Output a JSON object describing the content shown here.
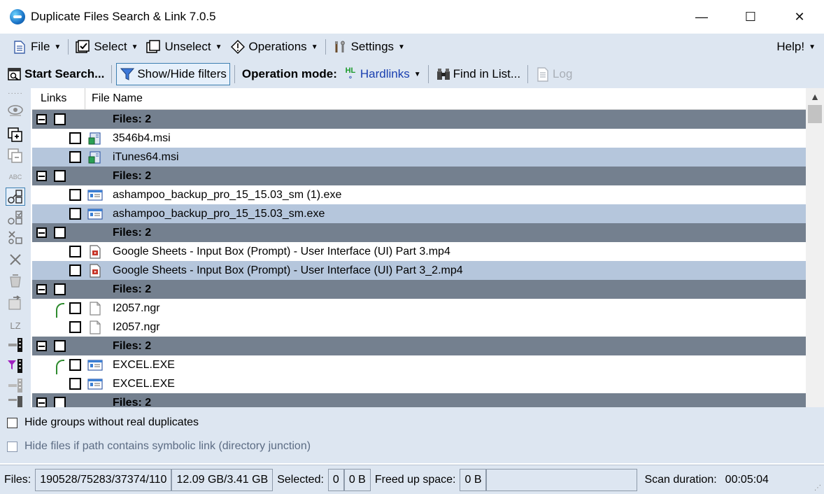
{
  "window": {
    "title": "Duplicate Files Search & Link 7.0.5",
    "minimize_glyph": "—",
    "maximize_glyph": "☐",
    "close_glyph": "✕"
  },
  "menu": {
    "file": "File",
    "select": "Select",
    "unselect": "Unselect",
    "operations": "Operations",
    "settings": "Settings",
    "help": "Help!"
  },
  "toolbar": {
    "start_search": "Start Search...",
    "show_hide_filters": "Show/Hide filters",
    "operation_mode_label": "Operation mode:",
    "hardlinks_badge": "HL",
    "operation_mode_value": "Hardlinks",
    "find_in_list": "Find in List...",
    "log": "Log"
  },
  "sidebar": {
    "icons": [
      "grip-icon",
      "eye-icon",
      "add-copy-icon",
      "remove-copy-icon",
      "abc-icon",
      "link-compare-icon",
      "link-check-icon",
      "link-cross-icon",
      "delete-icon",
      "recycle-icon",
      "move-icon",
      "lz-icon",
      "column-icon",
      "filter-column-icon",
      "column-alt-icon",
      "column-extra-icon"
    ],
    "abc_text": "ABC",
    "lz_text": "LZ"
  },
  "list": {
    "columns": {
      "links": "Links",
      "file_name": "File Name"
    },
    "group_label": "Files: 2",
    "rows": [
      {
        "type": "group",
        "label": "Files: 2"
      },
      {
        "type": "file",
        "name": "3546b4.msi",
        "icon": "msi-icon",
        "linked": false,
        "alt": false
      },
      {
        "type": "file",
        "name": "iTunes64.msi",
        "icon": "msi-icon",
        "linked": false,
        "alt": true
      },
      {
        "type": "group",
        "label": "Files: 2"
      },
      {
        "type": "file",
        "name": "ashampoo_backup_pro_15_15.03_sm (1).exe",
        "icon": "exe-icon",
        "linked": false,
        "alt": false
      },
      {
        "type": "file",
        "name": "ashampoo_backup_pro_15_15.03_sm.exe",
        "icon": "exe-icon",
        "linked": false,
        "alt": true
      },
      {
        "type": "group",
        "label": "Files: 2"
      },
      {
        "type": "file",
        "name": "Google Sheets - Input Box (Prompt) - User Interface (UI) Part 3.mp4",
        "icon": "video-icon",
        "linked": false,
        "alt": false
      },
      {
        "type": "file",
        "name": "Google Sheets - Input Box (Prompt) - User Interface (UI) Part 3_2.mp4",
        "icon": "video-icon",
        "linked": false,
        "alt": true
      },
      {
        "type": "group",
        "label": "Files: 2"
      },
      {
        "type": "file",
        "name": "I2057.ngr",
        "icon": "document-icon",
        "linked": true,
        "alt": false
      },
      {
        "type": "file",
        "name": "I2057.ngr",
        "icon": "document-icon",
        "linked": true,
        "alt": false
      },
      {
        "type": "group",
        "label": "Files: 2"
      },
      {
        "type": "file",
        "name": "EXCEL.EXE",
        "icon": "exe-icon",
        "linked": true,
        "alt": false
      },
      {
        "type": "file",
        "name": "EXCEL.EXE",
        "icon": "exe-icon",
        "linked": true,
        "alt": false
      },
      {
        "type": "group",
        "label": "Files: 2"
      }
    ]
  },
  "options": {
    "hide_groups": "Hide groups without real duplicates",
    "hide_symlink": "Hide files if path contains symbolic link (directory junction)"
  },
  "status": {
    "files_label": "Files:",
    "files_value": "190528/75283/37374/110",
    "size_value": "12.09 GB/3.41 GB",
    "selected_label": "Selected:",
    "selected_count": "0",
    "selected_size": "0 B",
    "freed_label": "Freed up space:",
    "freed_value": "0 B",
    "scan_label": "Scan duration:",
    "scan_value": "00:05:04"
  }
}
